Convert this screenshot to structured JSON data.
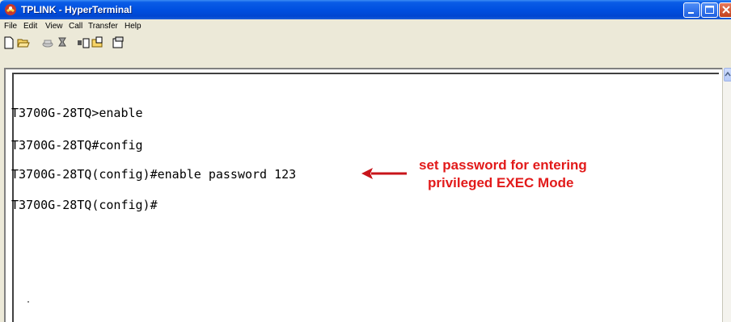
{
  "window": {
    "title": "TPLINK - HyperTerminal",
    "title_icon": "hyperterminal-phone-icon",
    "controls": [
      "minimize-icon",
      "maximize-icon",
      "close-icon"
    ]
  },
  "menubar": {
    "items": [
      "File",
      "Edit",
      "View",
      "Call",
      "Transfer",
      "Help"
    ]
  },
  "toolbar": {
    "icons": [
      "new-icon",
      "open-icon",
      "phone-disconnect-icon",
      "dial-icon",
      "send-icon",
      "receive-icon",
      "properties-icon"
    ]
  },
  "terminal": {
    "lines": [
      "T3700G-28TQ>enable",
      "T3700G-28TQ#config",
      "T3700G-28TQ(config)#enable password 123",
      "T3700G-28TQ(config)#"
    ]
  },
  "annotation": {
    "line1": "set password for entering",
    "line2": "privileged EXEC Mode",
    "color": "#e21a1a"
  },
  "colors": {
    "titlebar": "#0050e0",
    "chrome": "#ece9d8",
    "terminal_bg": "#ffffff"
  }
}
